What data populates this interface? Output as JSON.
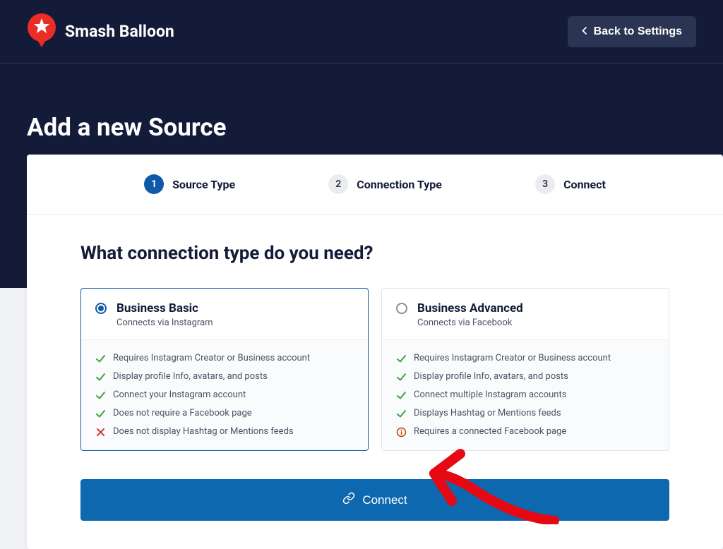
{
  "brand": "Smash Balloon",
  "header": {
    "back_label": "Back to Settings"
  },
  "page_title": "Add a new Source",
  "stepper": {
    "steps": [
      {
        "num": "1",
        "label": "Source Type"
      },
      {
        "num": "2",
        "label": "Connection Type"
      },
      {
        "num": "3",
        "label": "Connect"
      }
    ],
    "active_index": 0
  },
  "question": "What connection type do you need?",
  "options": [
    {
      "title": "Business Basic",
      "subtitle": "Connects via Instagram",
      "selected": true,
      "features": [
        {
          "icon": "check",
          "text": "Requires Instagram Creator or Business account"
        },
        {
          "icon": "check",
          "text": "Display profile Info, avatars, and posts"
        },
        {
          "icon": "check",
          "text": "Connect your Instagram account"
        },
        {
          "icon": "check",
          "text": "Does not require a Facebook page"
        },
        {
          "icon": "cross",
          "text": "Does not display Hashtag or Mentions feeds"
        }
      ]
    },
    {
      "title": "Business Advanced",
      "subtitle": "Connects via Facebook",
      "selected": false,
      "features": [
        {
          "icon": "check",
          "text": "Requires Instagram Creator or Business account"
        },
        {
          "icon": "check",
          "text": "Display profile Info, avatars, and posts"
        },
        {
          "icon": "check",
          "text": "Connect multiple Instagram accounts"
        },
        {
          "icon": "check",
          "text": "Displays Hashtag or Mentions feeds"
        },
        {
          "icon": "info",
          "text": "Requires a connected Facebook page"
        }
      ]
    }
  ],
  "connect_label": "Connect"
}
